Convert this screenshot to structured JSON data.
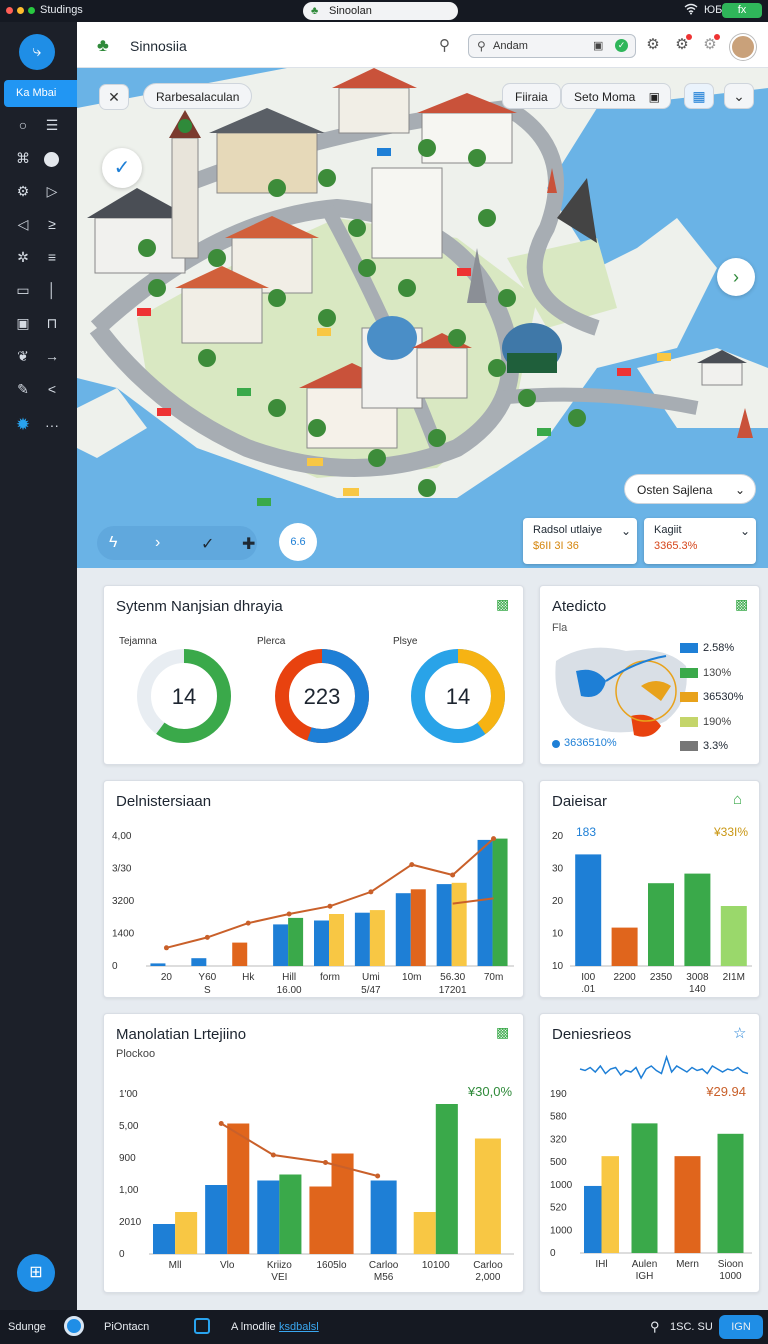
{
  "topbar": {
    "app_name": "Studings",
    "tab_title": "Sinoolan",
    "status_text": "ЮБ",
    "battery": "fx"
  },
  "header": {
    "logo_text": "Sinnosiia",
    "search_value": "Andam"
  },
  "sidebar": {
    "active_label": "Ka Mbai"
  },
  "map": {
    "search_chip": "Rarbesalaculan",
    "chip_right_1": "Fiiraia",
    "chip_right_2": "Seto Moma",
    "dropdown_label": "Osten Sajlena",
    "round_button_label": "6.6",
    "panel_1": {
      "title": "Radsol utlaiye",
      "value": "$6II 3I 36"
    },
    "panel_2": {
      "title": "Kagiit",
      "value": "3365.3%"
    }
  },
  "card_donuts": {
    "title": "Sytenm Nanjsian dhrayia",
    "donuts": [
      {
        "label": "Tejamna",
        "value": "14",
        "fill": 0.6,
        "color": "#3aa94a"
      },
      {
        "label": "Plerca",
        "value": "223",
        "fill": 0.55,
        "color": "#1e7fd6",
        "color2": "#e8420f"
      },
      {
        "label": "Plsye",
        "value": "14",
        "fill": 0.4,
        "color": "#f6b313",
        "color2": "#29a3e8"
      }
    ]
  },
  "card_map": {
    "title": "Atedicto",
    "subtitle": "Fla",
    "legend": [
      {
        "value": "2.58%",
        "color": "#1e7fd6"
      },
      {
        "value": "130%",
        "color": "#3aa94a"
      },
      {
        "value": "36530%",
        "color": "#e8a21b"
      },
      {
        "value": "190%",
        "color": "#c4d56a"
      },
      {
        "value": "3.3%",
        "color": "#777777"
      }
    ],
    "footer_value": "3636510%"
  },
  "card_bar1": {
    "title": "Delnistersiaan",
    "chart_data": {
      "type": "bar",
      "yticks": [
        "4,00",
        "3/30",
        "3200",
        "1400",
        "0"
      ],
      "categories": [
        "20",
        "Y60",
        "Hk",
        "Hill",
        "form",
        "Umi",
        "10m",
        "56.30",
        "70m"
      ],
      "sublabels": [
        "",
        "S",
        "",
        "16.00",
        "",
        "5/47",
        "",
        "17201",
        ""
      ],
      "series": [
        {
          "values": [
            0.02,
            0.06,
            0.18,
            0.32,
            0.35,
            0.41,
            0.56,
            0.63,
            0.97
          ],
          "colors": [
            "#1e7fd6",
            "#1e7fd6",
            "#e0651c",
            "#1e7fd6",
            "#1e7fd6",
            "#1e7fd6",
            "#1e7fd6",
            "#1e7fd6",
            "#1e7fd6"
          ]
        },
        {
          "values": [
            0,
            0,
            0,
            0.37,
            0.4,
            0.43,
            0.59,
            0.64,
            0.98
          ],
          "colors": [
            "",
            "",
            "",
            "#3aa94a",
            "#f8c744",
            "#f8c744",
            "#e0651c",
            "#f8c744",
            "#3aa94a"
          ]
        }
      ],
      "line": [
        0.14,
        0.22,
        0.33,
        0.4,
        0.46,
        0.57,
        0.78,
        0.7,
        0.98
      ],
      "line2": [
        null,
        null,
        null,
        null,
        null,
        null,
        null,
        0.48,
        0.52
      ]
    }
  },
  "card_bar2": {
    "title": "Daieisar",
    "badge_left": "183",
    "badge_right": "¥33I%",
    "chart_data": {
      "type": "bar",
      "yticks": [
        "20",
        "30",
        "20",
        "10",
        "10"
      ],
      "categories": [
        "I00",
        "2200",
        "2350",
        "3008",
        "2I1M"
      ],
      "sublabels": [
        ".01",
        "",
        "",
        "140",
        ""
      ],
      "values": [
        0.93,
        0.32,
        0.69,
        0.77,
        0.5
      ],
      "colors": [
        "#1e7fd6",
        "#e0651c",
        "#3aa94a",
        "#3aa94a",
        "#9ad86b"
      ]
    }
  },
  "card_bar3": {
    "title": "Manolatian Lrtejiino",
    "subtitle": "Plockoo",
    "badge": "¥30,0%",
    "chart_data": {
      "type": "bar",
      "yticks": [
        "1'00",
        "5,00",
        "900",
        "1,00",
        "2010",
        "0"
      ],
      "categories": [
        "Mll",
        "Vlo",
        "Kriizo",
        "1605lo",
        "Carloo",
        "10100",
        "Carloo"
      ],
      "sublabels": [
        "",
        "",
        "VEI",
        "",
        "M56",
        "",
        "2,000"
      ],
      "groups": [
        [
          {
            "v": 0.2,
            "c": "#1e7fd6"
          },
          {
            "v": 0.28,
            "c": "#f8c744"
          }
        ],
        [
          {
            "v": 0.46,
            "c": "#1e7fd6"
          },
          {
            "v": 0.87,
            "c": "#e0651c"
          }
        ],
        [
          {
            "v": 0.49,
            "c": "#1e7fd6"
          },
          {
            "v": 0.53,
            "c": "#3aa94a"
          }
        ],
        [
          {
            "v": 0.45,
            "c": "#e0651c"
          },
          {
            "v": 0.67,
            "c": "#e0651c"
          }
        ],
        [
          {
            "v": 0.49,
            "c": "#1e7fd6"
          }
        ],
        [
          {
            "v": 0.28,
            "c": "#f8c744"
          },
          {
            "v": 1.0,
            "c": "#3aa94a"
          }
        ],
        [
          {
            "v": 0.77,
            "c": "#f8c744"
          }
        ]
      ],
      "line": [
        null,
        0.87,
        0.66,
        0.61,
        0.52,
        null,
        null
      ]
    }
  },
  "card_bar4": {
    "title": "Deniesrieos",
    "badge": "¥29.94",
    "chart_data": {
      "type": "bar",
      "yticks": [
        "190",
        "580",
        "320",
        "500",
        "1000",
        "520",
        "1000",
        "0"
      ],
      "categories": [
        "IHl",
        "Aulen",
        "Mern",
        "Sioon"
      ],
      "sublabels": [
        "",
        "IGH",
        "",
        "1000"
      ],
      "groups": [
        [
          {
            "v": 0.45,
            "c": "#1e7fd6"
          },
          {
            "v": 0.65,
            "c": "#f8c744"
          }
        ],
        [
          {
            "v": 0.87,
            "c": "#3aa94a"
          }
        ],
        [
          {
            "v": 0.65,
            "c": "#e0651c"
          }
        ],
        [
          {
            "v": 0.8,
            "c": "#3aa94a"
          }
        ]
      ],
      "spark": [
        0.5,
        0.45,
        0.55,
        0.4,
        0.6,
        0.35,
        0.5,
        0.55,
        0.3,
        0.45,
        0.4,
        0.55,
        0.2,
        0.5,
        0.6,
        0.45,
        0.35,
        0.9,
        0.4,
        0.6,
        0.5,
        0.4,
        0.55,
        0.45,
        0.5,
        0.35,
        0.6,
        0.5,
        0.4,
        0.5,
        0.45,
        0.55,
        0.4,
        0.35
      ]
    }
  },
  "bottombar": {
    "left_label": "Sdunge",
    "mid_label": "PiOntacn",
    "link_prefix": "A lmodlie",
    "link": "ksdbalsl",
    "right_value": "1SC. SU",
    "button": "IGN"
  }
}
